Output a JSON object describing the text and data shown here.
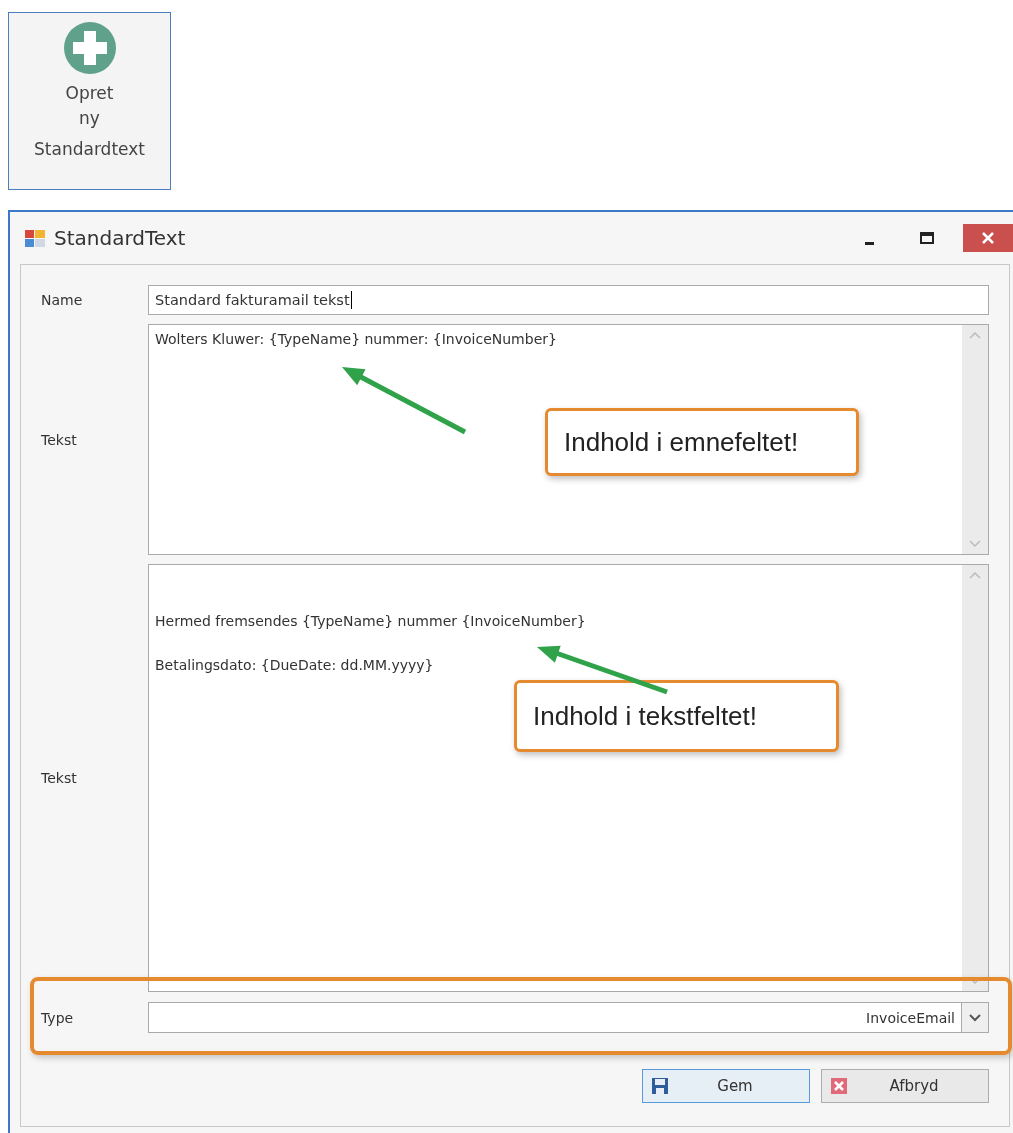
{
  "ribbon_button": {
    "label_lines": [
      "Opret",
      "ny"
    ],
    "group": "Standardtext"
  },
  "window": {
    "title": "StandardText"
  },
  "form": {
    "name": {
      "label": "Name",
      "value": "Standard fakturamail tekst"
    },
    "subject": {
      "label": "Tekst",
      "lines": [
        "Wolters Kluwer: {TypeName} nummer: {InvoiceNumber}"
      ]
    },
    "body": {
      "label": "Tekst",
      "lines": [
        "Hermed fremsendes {TypeName} nummer {InvoiceNumber}",
        "Betalingsdato: {DueDate: dd.MM.yyyy}"
      ]
    },
    "type": {
      "label": "Type",
      "value": "InvoiceEmail"
    }
  },
  "buttons": [
    {
      "label": "Gem",
      "kind": "save",
      "default": true
    },
    {
      "label": "Afbryd",
      "kind": "cancel",
      "default": false
    }
  ],
  "annotations": [
    {
      "text": "Indhold i emnefeltet!"
    },
    {
      "text": "Indhold i tekstfeltet!"
    }
  ]
}
